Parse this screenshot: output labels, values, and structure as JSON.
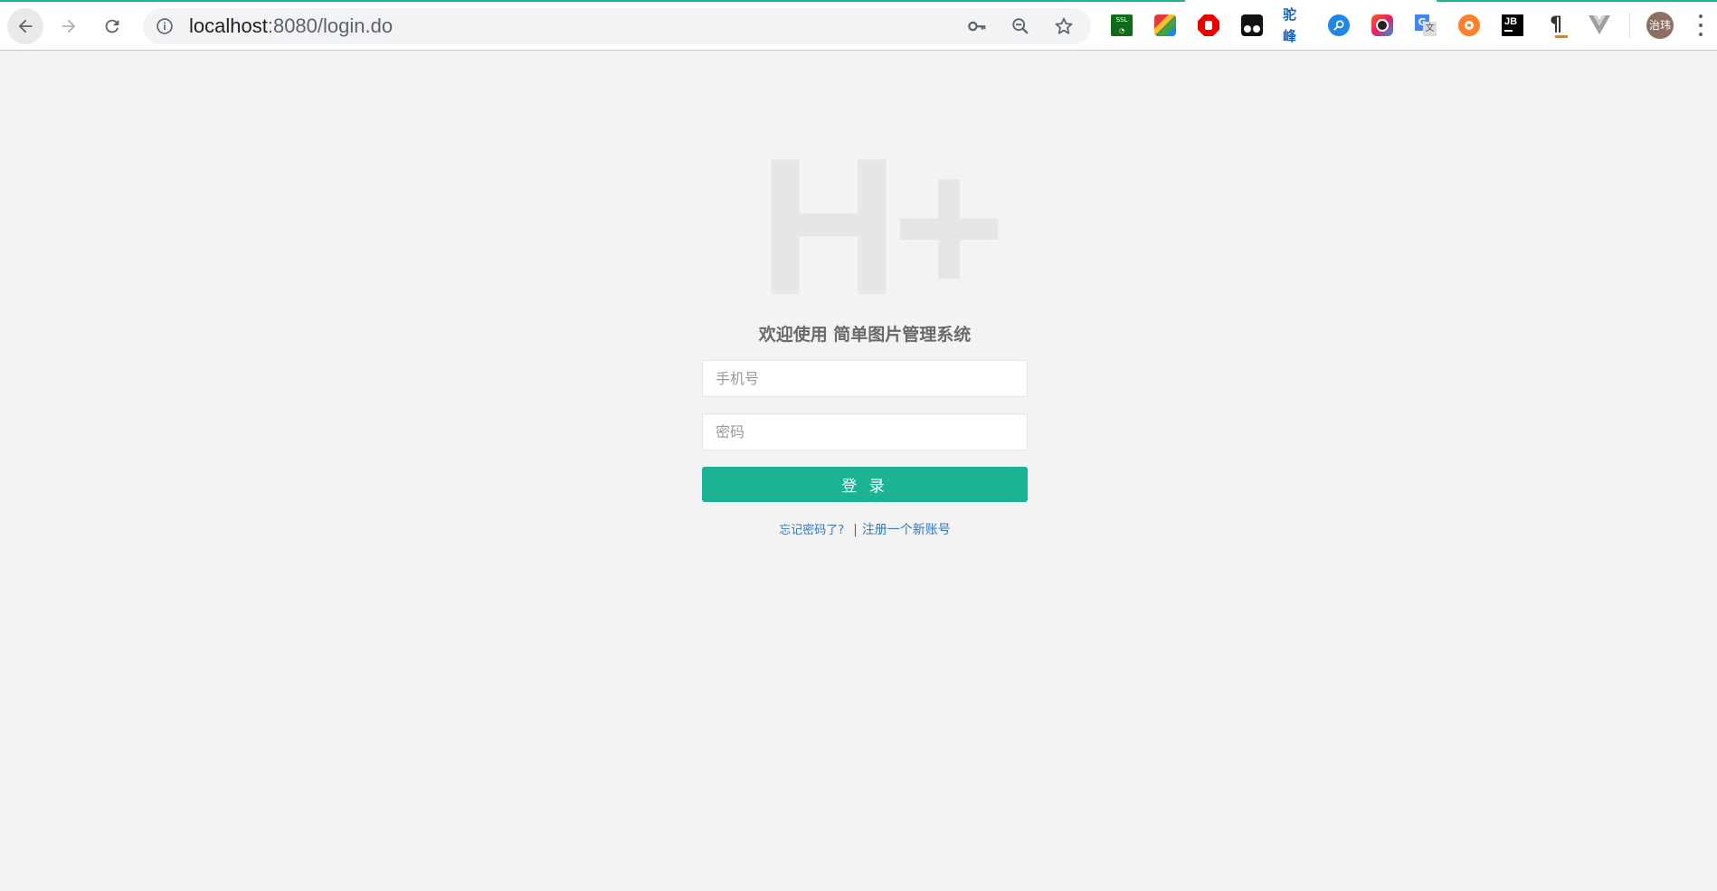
{
  "browser": {
    "url_host": "localhost",
    "url_rest": ":8080/login.do",
    "avatar_text": "治玮"
  },
  "extensions": [
    "ssl-icon",
    "kaleidoscope-icon",
    "adblock-icon",
    "tampermonkey-icon",
    "eolinker-icon",
    "search-tool-icon",
    "camera-icon",
    "translate-icon",
    "bug-icon",
    "jetbrains-icon",
    "formatter-icon",
    "vue-devtools-icon"
  ],
  "page": {
    "logo_text": "H+",
    "welcome": "欢迎使用 简单图片管理系统",
    "phone_placeholder": "手机号",
    "password_placeholder": "密码",
    "login_label": "登 录",
    "forgot_link": "忘记密码了?",
    "separator": "|",
    "register_link": "注册一个新账号"
  },
  "colors": {
    "accent": "#1ab394",
    "link": "#337ab7",
    "background": "#f3f3f4"
  }
}
